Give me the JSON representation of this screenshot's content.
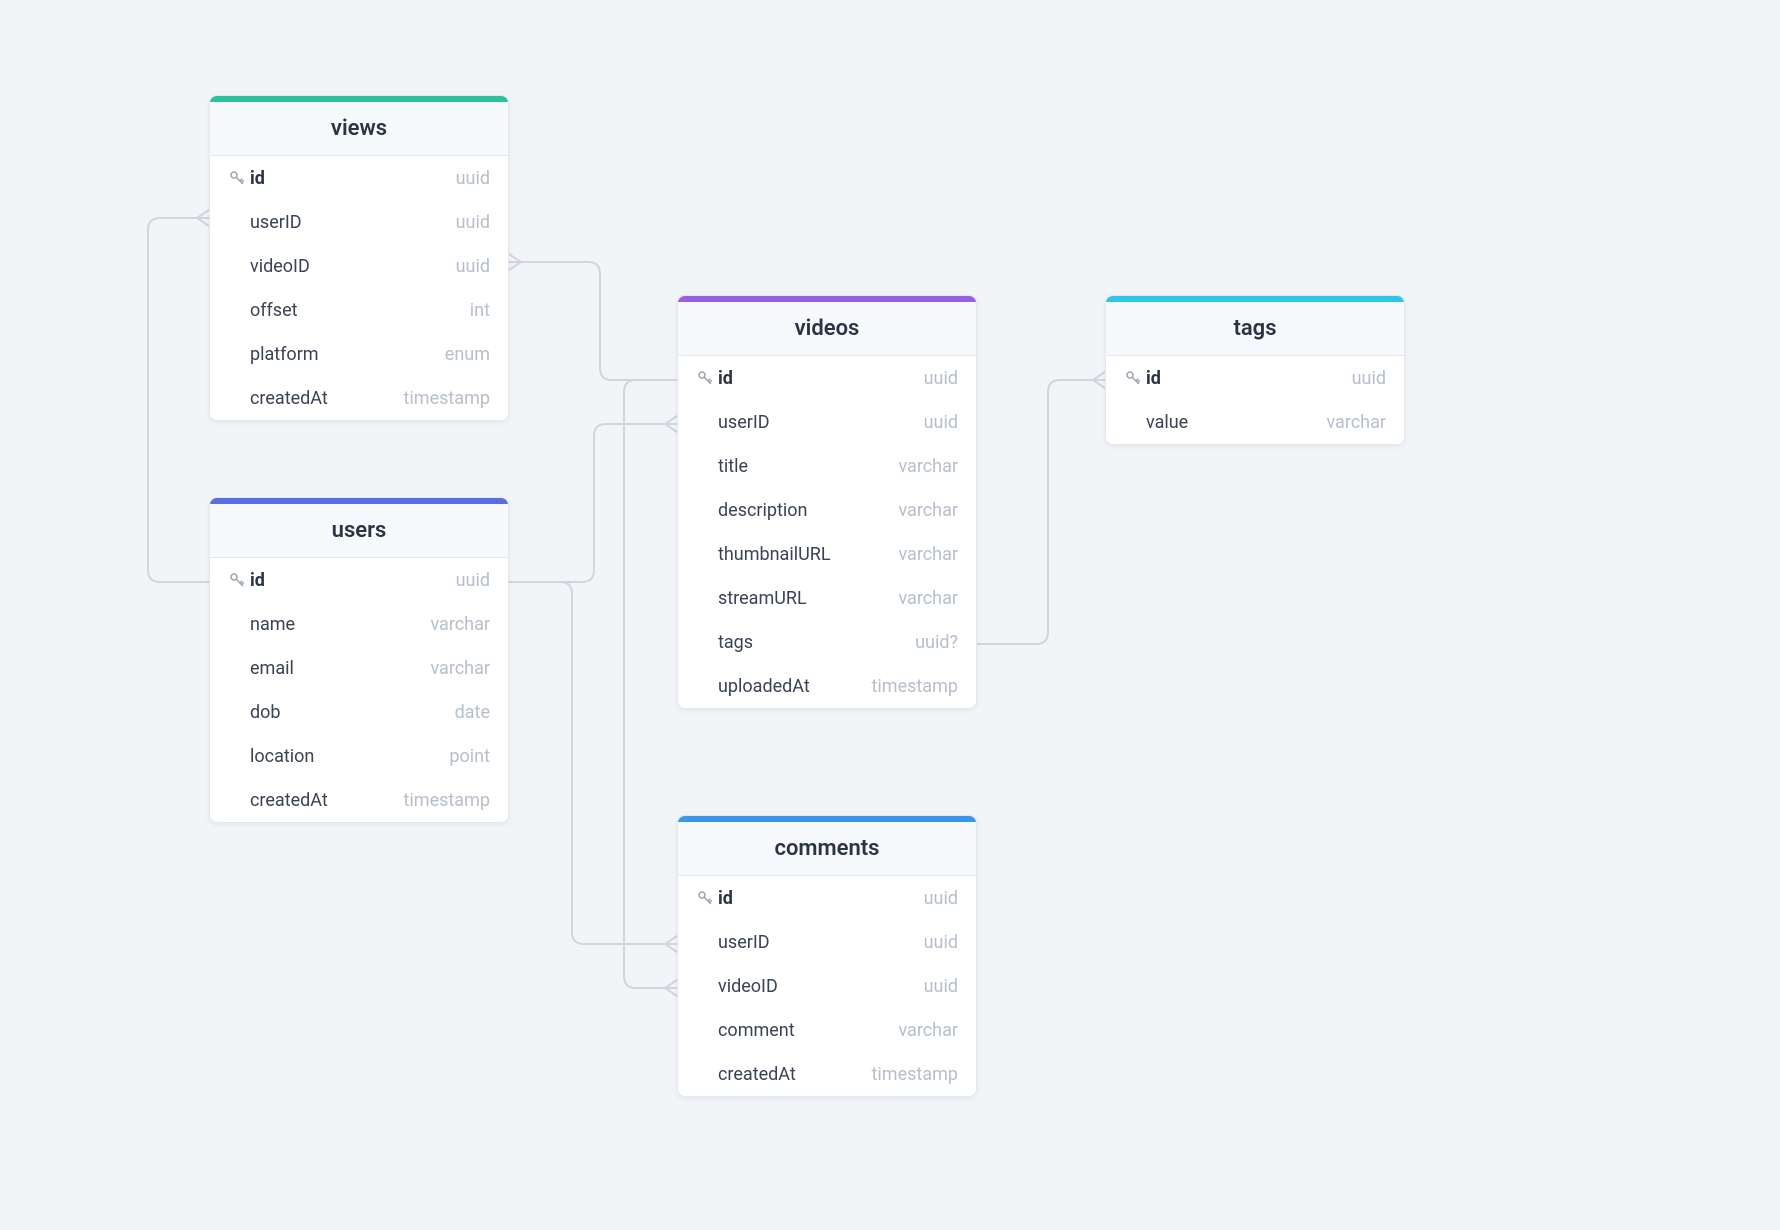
{
  "entities": {
    "views": {
      "title": "views",
      "accent": "#2cc09c",
      "fields": [
        {
          "name": "id",
          "type": "uuid",
          "pk": true
        },
        {
          "name": "userID",
          "type": "uuid",
          "pk": false
        },
        {
          "name": "videoID",
          "type": "uuid",
          "pk": false
        },
        {
          "name": "offset",
          "type": "int",
          "pk": false
        },
        {
          "name": "platform",
          "type": "enum",
          "pk": false
        },
        {
          "name": "createdAt",
          "type": "timestamp",
          "pk": false
        }
      ]
    },
    "users": {
      "title": "users",
      "accent": "#5a6ee0",
      "fields": [
        {
          "name": "id",
          "type": "uuid",
          "pk": true
        },
        {
          "name": "name",
          "type": "varchar",
          "pk": false
        },
        {
          "name": "email",
          "type": "varchar",
          "pk": false
        },
        {
          "name": "dob",
          "type": "date",
          "pk": false
        },
        {
          "name": "location",
          "type": "point",
          "pk": false
        },
        {
          "name": "createdAt",
          "type": "timestamp",
          "pk": false
        }
      ]
    },
    "videos": {
      "title": "videos",
      "accent": "#9a5ee6",
      "fields": [
        {
          "name": "id",
          "type": "uuid",
          "pk": true
        },
        {
          "name": "userID",
          "type": "uuid",
          "pk": false
        },
        {
          "name": "title",
          "type": "varchar",
          "pk": false
        },
        {
          "name": "description",
          "type": "varchar",
          "pk": false
        },
        {
          "name": "thumbnailURL",
          "type": "varchar",
          "pk": false
        },
        {
          "name": "streamURL",
          "type": "varchar",
          "pk": false
        },
        {
          "name": "tags",
          "type": "uuid?",
          "pk": false
        },
        {
          "name": "uploadedAt",
          "type": "timestamp",
          "pk": false
        }
      ]
    },
    "comments": {
      "title": "comments",
      "accent": "#3a96e8",
      "fields": [
        {
          "name": "id",
          "type": "uuid",
          "pk": true
        },
        {
          "name": "userID",
          "type": "uuid",
          "pk": false
        },
        {
          "name": "videoID",
          "type": "uuid",
          "pk": false
        },
        {
          "name": "comment",
          "type": "varchar",
          "pk": false
        },
        {
          "name": "createdAt",
          "type": "timestamp",
          "pk": false
        }
      ]
    },
    "tags": {
      "title": "tags",
      "accent": "#2cc7e6",
      "fields": [
        {
          "name": "id",
          "type": "uuid",
          "pk": true
        },
        {
          "name": "value",
          "type": "varchar",
          "pk": false
        }
      ]
    }
  },
  "relationships": [
    {
      "from": "views.videoID",
      "to": "videos.id"
    },
    {
      "from": "views.userID",
      "to": "users.id"
    },
    {
      "from": "videos.userID",
      "to": "users.id"
    },
    {
      "from": "videos.tags",
      "to": "tags.id"
    },
    {
      "from": "comments.userID",
      "to": "users.id"
    },
    {
      "from": "comments.videoID",
      "to": "videos.id"
    }
  ]
}
